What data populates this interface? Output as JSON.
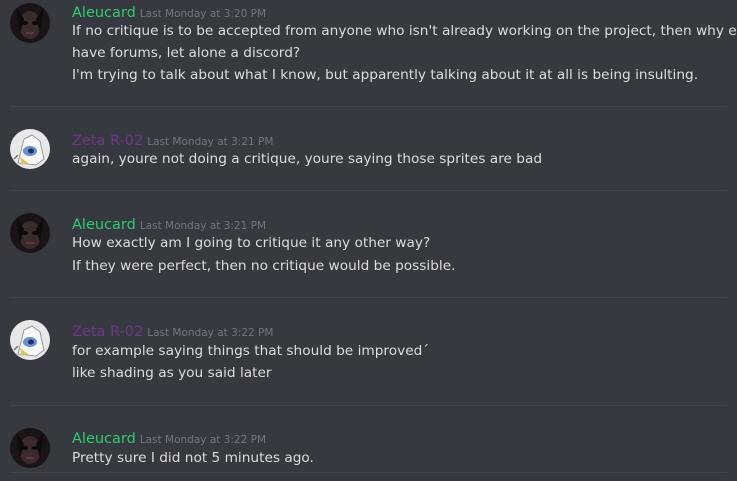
{
  "colors": {
    "background": "#36393f",
    "aleucard_name": "#2ecc71",
    "zeta_name": "#71368a",
    "message_text": "#dcddde",
    "timestamp": "#72767d"
  },
  "messages": [
    {
      "author": "Aleucard",
      "timestamp": "Last Monday at 3:20 PM",
      "avatar_icon": "dark-figure-avatar-icon",
      "lines": [
        "If no critique is to be accepted from anyone who isn't already working on the project, then why even",
        "have forums, let alone a discord?",
        "I'm trying to talk about what I know, but apparently talking about it at all is being insulting."
      ]
    },
    {
      "author": "Zeta R-02",
      "timestamp": "Last Monday at 3:21 PM",
      "avatar_icon": "white-robot-avatar-icon",
      "lines": [
        "again, youre not doing a critique, youre saying those sprites are bad"
      ]
    },
    {
      "author": "Aleucard",
      "timestamp": "Last Monday at 3:21 PM",
      "avatar_icon": "dark-figure-avatar-icon",
      "lines": [
        "How exactly am I going to critique it any other way?",
        "If they were perfect, then no critique would be possible."
      ]
    },
    {
      "author": "Zeta R-02",
      "timestamp": "Last Monday at 3:22 PM",
      "avatar_icon": "white-robot-avatar-icon",
      "lines": [
        "for example saying things that should be improved´",
        "like shading as you said later"
      ]
    },
    {
      "author": "Aleucard",
      "timestamp": "Last Monday at 3:22 PM",
      "avatar_icon": "dark-figure-avatar-icon",
      "lines": [
        "Pretty sure I did not 5 minutes ago."
      ]
    }
  ]
}
